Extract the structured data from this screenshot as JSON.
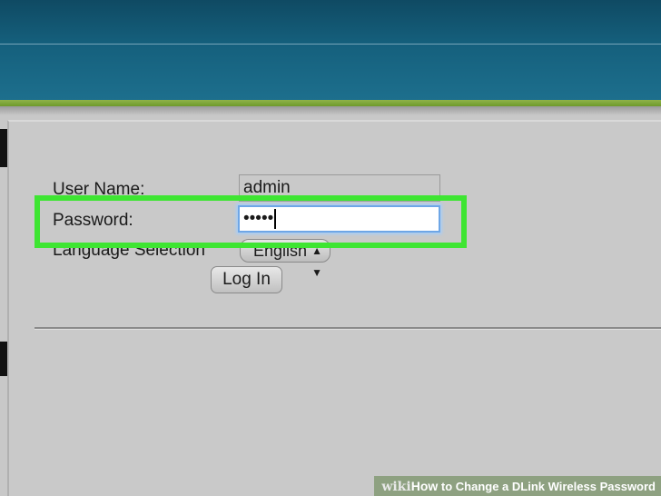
{
  "form": {
    "username_label": "User Name:",
    "username_value": "admin",
    "password_label": "Password:",
    "password_value": "•••••",
    "language_label": "Language Selection",
    "language_selected": "English",
    "login_button": "Log In"
  },
  "watermark": {
    "brand": "wiki",
    "how": "How",
    "title": " to Change a DLink Wireless Password"
  },
  "colors": {
    "header": "#15607d",
    "accent_bar": "#7ea53a",
    "highlight": "#3ee532",
    "focus_ring": "#6ea6e6"
  },
  "icons": {
    "dropdown": "chevron-down-icon"
  }
}
